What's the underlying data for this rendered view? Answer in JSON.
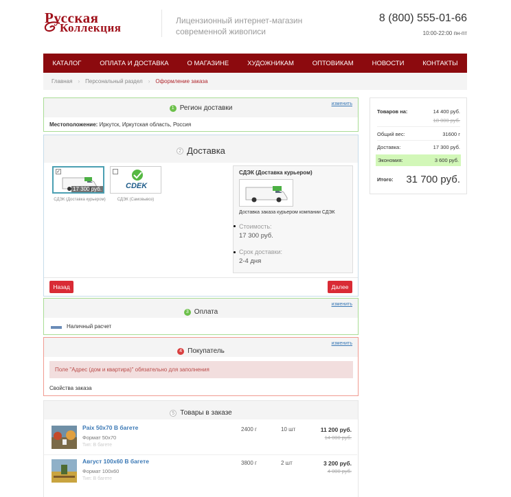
{
  "header": {
    "logo_line1": "Русская",
    "logo_line2": "Коллекция",
    "tagline_line1": "Лицензионный интернет-магазин",
    "tagline_line2": "современной живописи",
    "phone": "8 (800) 555-01-66",
    "hours": "10:00-22:00 пн-пт"
  },
  "nav": {
    "items": [
      "КАТАЛОГ",
      "ОПЛАТА И ДОСТАВКА",
      "О МАГАЗИНЕ",
      "ХУДОЖНИКАМ",
      "ОПТОВИКАМ",
      "НОВОСТИ",
      "КОНТАКТЫ"
    ]
  },
  "breadcrumb": {
    "items": [
      "Главная",
      "Персональный раздел",
      "Оформление заказа"
    ],
    "separator": "›"
  },
  "region": {
    "badge": "1",
    "title": "Регион доставки",
    "change": "изменить",
    "location_label": "Местоположение:",
    "location_value": "Иркутск, Иркутская область, Россия"
  },
  "delivery": {
    "badge": "2",
    "title": "Доставка",
    "options": [
      {
        "label": "СДЭК (Доставка курьером)",
        "price": "17 300 руб.",
        "selected": true
      },
      {
        "label": "СДЭК (Самовывоз)",
        "selected": false
      }
    ],
    "logo_text": "CDEK",
    "detail": {
      "title": "СДЭК (Доставка курьером)",
      "description": "Доставка заказа курьером компании СДЭК",
      "cost_label": "Стоимость:",
      "cost_value": "17 300 руб.",
      "term_label": "Срок доставки:",
      "term_value": "2-4 дня"
    },
    "back_button": "Назад",
    "next_button": "Далее"
  },
  "payment": {
    "badge": "3",
    "title": "Оплата",
    "change": "изменить",
    "method": "Наличный расчет"
  },
  "buyer": {
    "badge": "4",
    "title": "Покупатель",
    "change": "изменить",
    "error": "Поле \"Адрес (дом и квартира)\" обязательно для заполнения",
    "props_label": "Свойства заказа"
  },
  "products": {
    "badge": "5",
    "title": "Товары в заказе",
    "items": [
      {
        "name": "Paix 50x70 В багете",
        "format": "Формат 50x70",
        "faded": "Тип: В багете",
        "weight": "2400 г",
        "qty": "10 шт",
        "price": "11 200 руб.",
        "old_price": "14 000 руб."
      },
      {
        "name": "Август 100x60 В багете",
        "format": "Формат 100x60",
        "faded": "Тип: В багете",
        "weight": "3800 г",
        "qty": "2 шт",
        "price": "3 200 руб.",
        "old_price": "4 000 руб."
      }
    ]
  },
  "summary": {
    "goods_label": "Товаров на:",
    "goods_value": "14 400 руб.",
    "goods_old": "18 000 руб.",
    "weight_label": "Общий вес:",
    "weight_value": "31600 г",
    "delivery_label": "Доставка:",
    "delivery_value": "17 300 руб.",
    "economy_label": "Экономия:",
    "economy_value": "3 600 руб.",
    "total_label": "Итого:",
    "total_value": "31 700 руб."
  },
  "colors": {
    "brand": "#8c0a0e",
    "button_red": "#d92b35",
    "link_blue": "#3a78b5",
    "panel_green": "#a8dc94",
    "panel_blue": "#c6dcea",
    "panel_red": "#f09a90",
    "economy_bg": "#d2f7b8"
  }
}
